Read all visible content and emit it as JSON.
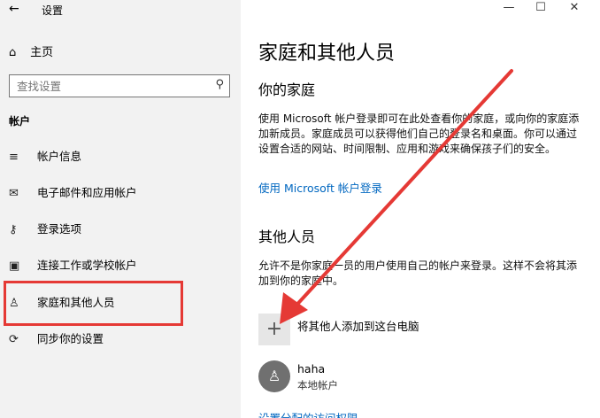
{
  "window": {
    "title": "设置"
  },
  "sidebar": {
    "home_label": "主页",
    "search_placeholder": "查找设置",
    "section_label": "帐户",
    "items": [
      {
        "label": "帐户信息",
        "icon": "person-card-icon"
      },
      {
        "label": "电子邮件和应用帐户",
        "icon": "mail-icon"
      },
      {
        "label": "登录选项",
        "icon": "key-icon"
      },
      {
        "label": "连接工作或学校帐户",
        "icon": "briefcase-icon"
      },
      {
        "label": "家庭和其他人员",
        "icon": "person-add-icon"
      },
      {
        "label": "同步你的设置",
        "icon": "sync-icon"
      }
    ]
  },
  "main": {
    "title": "家庭和其他人员",
    "family": {
      "heading": "你的家庭",
      "description": "使用 Microsoft 帐户登录即可在此处查看你的家庭，或向你的家庭添加新成员。家庭成员可以获得他们自己的登录名和桌面。你可以通过设置合适的网站、时间限制、应用和游戏来确保孩子们的安全。",
      "link": "使用 Microsoft 帐户登录"
    },
    "others": {
      "heading": "其他人员",
      "description": "允许不是你家庭一员的用户使用自己的帐户来登录。这样不会将其添加到你的家庭中。",
      "add_label": "将其他人添加到这台电脑",
      "user": {
        "name": "haha",
        "type": "本地帐户"
      },
      "bottom_link": "设置分配的访问权限"
    }
  },
  "annotation": {
    "highlight_color": "#e53935"
  }
}
